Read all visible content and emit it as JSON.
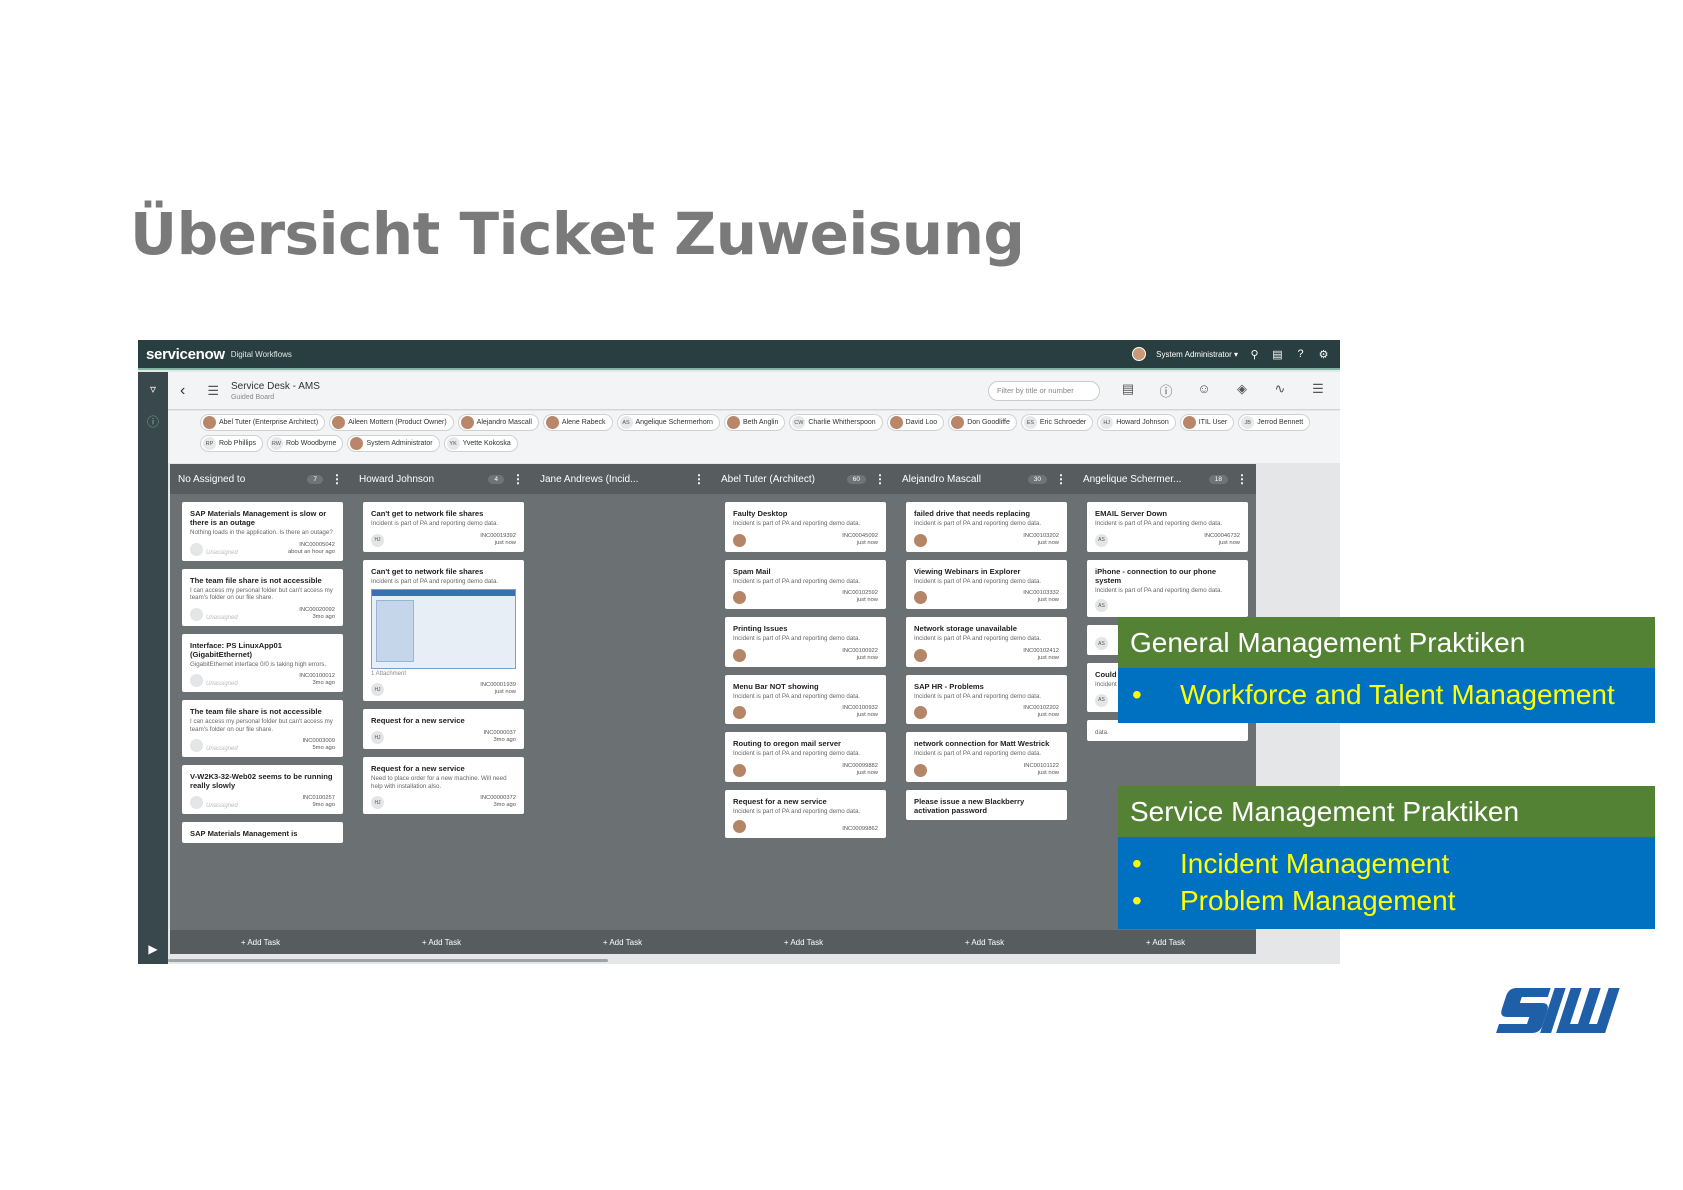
{
  "slide": {
    "title": "Übersicht Ticket Zuweisung"
  },
  "app": {
    "brand": "servicenow",
    "brand_sub": "Digital Workflows",
    "user": "System Administrator ▾",
    "board_name": "Service Desk - AMS",
    "board_sub": "Guided Board",
    "filter_placeholder": "Filter by title or number",
    "people": [
      {
        "initials": "",
        "name": "Abel Tuter (Enterprise Architect)",
        "photo": true
      },
      {
        "initials": "",
        "name": "Aileen Mottern (Product Owner)",
        "photo": true
      },
      {
        "initials": "",
        "name": "Alejandro Mascall",
        "photo": true
      },
      {
        "initials": "",
        "name": "Alene Rabeck",
        "photo": true
      },
      {
        "initials": "AS",
        "name": "Angelique Schermerhorn",
        "photo": false
      },
      {
        "initials": "",
        "name": "Beth Anglin",
        "photo": true
      },
      {
        "initials": "CW",
        "name": "Charlie Whitherspoon",
        "photo": false
      },
      {
        "initials": "",
        "name": "David Loo",
        "photo": true
      },
      {
        "initials": "",
        "name": "Don Goodliffe",
        "photo": true
      },
      {
        "initials": "ES",
        "name": "Eric Schroeder",
        "photo": false
      },
      {
        "initials": "HJ",
        "name": "Howard Johnson",
        "photo": false
      },
      {
        "initials": "",
        "name": "ITIL User",
        "photo": true
      },
      {
        "initials": "JB",
        "name": "Jerrod Bennett",
        "photo": false
      },
      {
        "initials": "RP",
        "name": "Rob Phillips",
        "photo": false
      },
      {
        "initials": "RW",
        "name": "Rob Woodbyrne",
        "photo": false
      },
      {
        "initials": "",
        "name": "System Administrator",
        "photo": true
      },
      {
        "initials": "YK",
        "name": "Yvette Kokoska",
        "photo": false
      }
    ],
    "add_task": "+ Add Task",
    "lanes": [
      {
        "name": "No Assigned to",
        "count": "7",
        "cards": [
          {
            "title": "SAP Materials Management is slow or there is an outage",
            "desc": "Nothing loads in the application. Is there an outage?",
            "av": "",
            "unassigned": "Unassigned",
            "number": "INC00005042",
            "time": "about an hour ago"
          },
          {
            "title": "The team file share is not accessible",
            "desc": "I can access my personal folder but can't access my team's folder on our file share.",
            "av": "",
            "unassigned": "Unassigned",
            "number": "INC00020092",
            "time": "3mo ago"
          },
          {
            "title": "Interface: PS LinuxApp01 (GigabitEthernet)",
            "desc": "GigabitEthernet interface 0/0 is taking high errors.",
            "av": "",
            "unassigned": "Unassigned",
            "number": "INC00100012",
            "time": "3mo ago"
          },
          {
            "title": "The team file share is not accessible",
            "desc": "I can access my personal folder but can't access my team's folder on our file share.",
            "av": "",
            "unassigned": "Unassigned",
            "number": "INC0003009",
            "time": "5mo ago"
          },
          {
            "title": "V-W2K3-32-Web02 seems to be running really slowly",
            "desc": "",
            "av": "",
            "unassigned": "Unassigned",
            "number": "INC0100257",
            "time": "9mo ago"
          },
          {
            "title": "SAP Materials Management is",
            "desc": "",
            "av": "",
            "unassigned": "",
            "number": "",
            "time": ""
          }
        ]
      },
      {
        "name": "Howard Johnson",
        "count": "4",
        "cards": [
          {
            "title": "Can't get to network file shares",
            "desc": "Incident is part of PA and reporting demo data.",
            "av": "HJ",
            "unassigned": "",
            "number": "INC00019392",
            "time": "just now"
          },
          {
            "title": "Can't get to network file shares",
            "desc": "Incident is part of PA and reporting demo data.",
            "av": "HJ",
            "unassigned": "",
            "number": "INC00001939",
            "time": "just now",
            "attachment": "1 Attachment"
          },
          {
            "title": "Request for a new service",
            "desc": "",
            "av": "HJ",
            "unassigned": "",
            "number": "INC0000037",
            "time": "3mo ago"
          },
          {
            "title": "Request for a new service",
            "desc": "Need to place order for a new machine. Will need help with installation also.",
            "av": "HJ",
            "unassigned": "",
            "number": "INC00000372",
            "time": "3mo ago"
          }
        ]
      },
      {
        "name": "Jane Andrews (Incid...",
        "count": "",
        "cards": []
      },
      {
        "name": "Abel Tuter (Architect)",
        "count": "60",
        "cards": [
          {
            "title": "Faulty Desktop",
            "desc": "Incident is part of PA and reporting demo data.",
            "av": "",
            "photo": true,
            "unassigned": "",
            "number": "INC00045092",
            "time": "just now"
          },
          {
            "title": "Spam Mail",
            "desc": "Incident is part of PA and reporting demo data.",
            "av": "",
            "photo": true,
            "unassigned": "",
            "number": "INC00102592",
            "time": "just now"
          },
          {
            "title": "Printing Issues",
            "desc": "Incident is part of PA and reporting demo data.",
            "av": "",
            "photo": true,
            "unassigned": "",
            "number": "INC00100922",
            "time": "just now"
          },
          {
            "title": "Menu Bar NOT showing",
            "desc": "Incident is part of PA and reporting demo data.",
            "av": "",
            "photo": true,
            "unassigned": "",
            "number": "INC00100932",
            "time": "just now"
          },
          {
            "title": "Routing to oregon mail server",
            "desc": "Incident is part of PA and reporting demo data.",
            "av": "",
            "photo": true,
            "unassigned": "",
            "number": "INC00099882",
            "time": "just now"
          },
          {
            "title": "Request for a new service",
            "desc": "Incident is part of PA and reporting demo data.",
            "av": "",
            "photo": true,
            "unassigned": "",
            "number": "INC00099862",
            "time": ""
          }
        ]
      },
      {
        "name": "Alejandro Mascall",
        "count": "30",
        "cards": [
          {
            "title": "failed drive that needs replacing",
            "desc": "Incident is part of PA and reporting demo data.",
            "av": "",
            "photo": true,
            "unassigned": "",
            "number": "INC00103202",
            "time": "just now"
          },
          {
            "title": "Viewing Webinars in Explorer",
            "desc": "Incident is part of PA and reporting demo data.",
            "av": "",
            "photo": true,
            "unassigned": "",
            "number": "INC00103332",
            "time": "just now"
          },
          {
            "title": "Network storage unavailable",
            "desc": "Incident is part of PA and reporting demo data.",
            "av": "",
            "photo": true,
            "unassigned": "",
            "number": "INC00102412",
            "time": "just now"
          },
          {
            "title": "SAP HR - Problems",
            "desc": "Incident is part of PA and reporting demo data.",
            "av": "",
            "photo": true,
            "unassigned": "",
            "number": "INC00102202",
            "time": "just now"
          },
          {
            "title": "network connection for Matt Westrick",
            "desc": "Incident is part of PA and reporting demo data.",
            "av": "",
            "photo": true,
            "unassigned": "",
            "number": "INC00101122",
            "time": "just now"
          },
          {
            "title": "Please issue a new Blackberry activation password",
            "desc": "",
            "av": "",
            "unassigned": "",
            "number": "",
            "time": ""
          }
        ]
      },
      {
        "name": "Angelique Schermer...",
        "count": "18",
        "cards": [
          {
            "title": "EMAIL Server Down",
            "desc": "Incident is part of PA and reporting demo data.",
            "av": "AS",
            "unassigned": "",
            "number": "INC00046732",
            "time": "just now"
          },
          {
            "title": "iPhone - connection to our phone system",
            "desc": "Incident is part of PA and reporting demo data.",
            "av": "AS",
            "unassigned": "",
            "number": "",
            "time": ""
          },
          {
            "title": "",
            "desc": "",
            "av": "AS",
            "unassigned": "",
            "number": "",
            "time": "just now"
          },
          {
            "title": "Could not log on to windows",
            "desc": "Incident is part of PA and reporting demo data.",
            "av": "AS",
            "unassigned": "",
            "number": "",
            "time": ""
          },
          {
            "title": "",
            "desc": "data.",
            "av": "",
            "unassigned": "",
            "number": "",
            "time": ""
          }
        ]
      }
    ]
  },
  "overlay": {
    "general": {
      "heading": "General Management Praktiken",
      "items": [
        "Workforce and Talent Management"
      ]
    },
    "service": {
      "heading": "Service Management Praktiken",
      "items": [
        "Incident Management",
        "Problem Management"
      ]
    },
    "bullet": "•",
    "colors": {
      "heading_bg": "#548235",
      "body_bg": "#0070c0",
      "item_text": "#ffff00"
    }
  },
  "logo": {
    "text": "SIW",
    "color": "#1f5fa8"
  }
}
